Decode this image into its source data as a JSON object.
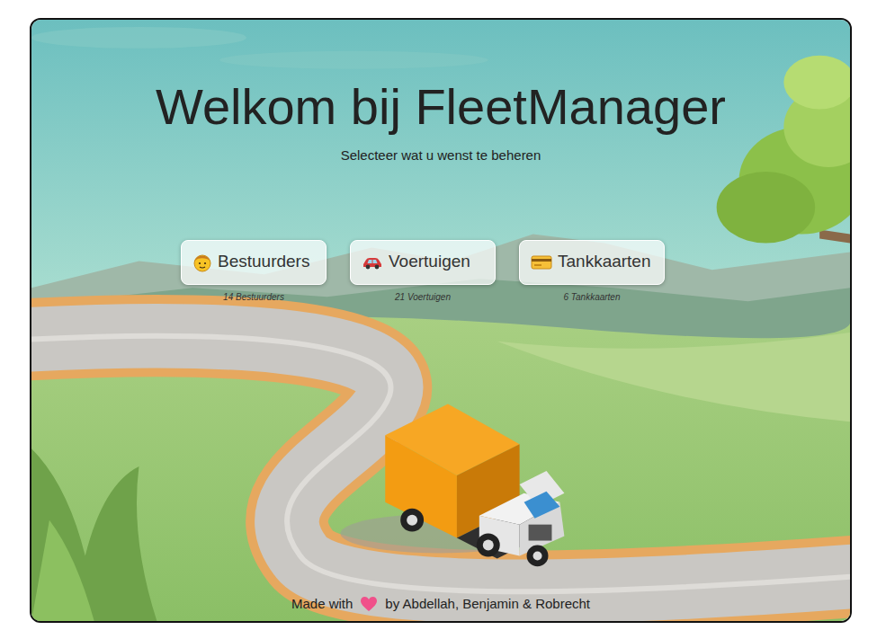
{
  "page": {
    "title": "Welkom bij FleetManager",
    "subtitle": "Selecteer wat u wenst te beheren"
  },
  "options": [
    {
      "kind": "driver",
      "label": "Bestuurders",
      "count": "14 Bestuurders"
    },
    {
      "kind": "vehicle",
      "label": "Voertuigen",
      "count": "21 Voertuigen"
    },
    {
      "kind": "card",
      "label": "Tankkaarten",
      "count": "6 Tankkaarten"
    }
  ],
  "footer": {
    "before": "Made with",
    "after": "by Abdellah, Benjamin & Robrecht"
  }
}
